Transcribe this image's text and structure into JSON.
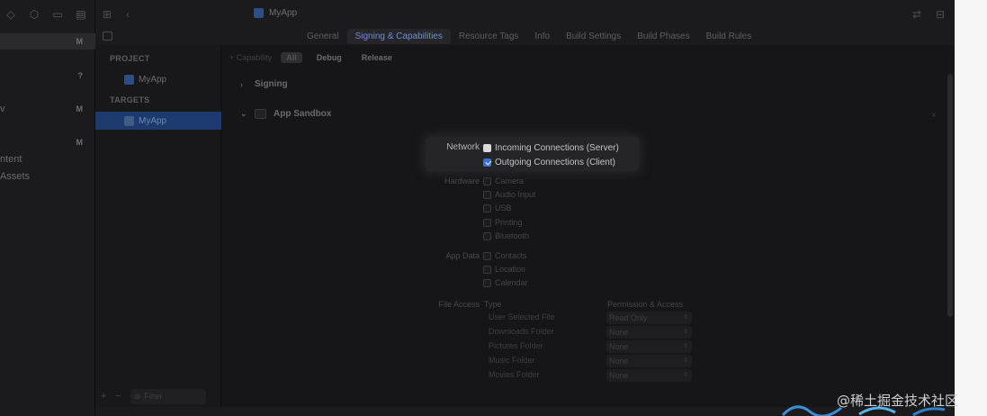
{
  "navigator": {
    "rows": [
      {
        "text": "",
        "badge": "M",
        "selected": true
      },
      {
        "text": "",
        "badge": "?"
      },
      {
        "text": "v",
        "badge": "M"
      },
      {
        "text": "",
        "badge": "M"
      },
      {
        "text": "ntent",
        "badge": ""
      },
      {
        "text": "Assets",
        "badge": ""
      }
    ]
  },
  "toolbar": {
    "project_name": "MyApp"
  },
  "tabs": [
    {
      "label": "General",
      "active": false
    },
    {
      "label": "Signing & Capabilities",
      "active": true
    },
    {
      "label": "Resource Tags",
      "active": false
    },
    {
      "label": "Info",
      "active": false
    },
    {
      "label": "Build Settings",
      "active": false
    },
    {
      "label": "Build Phases",
      "active": false
    },
    {
      "label": "Build Rules",
      "active": false
    }
  ],
  "project_list": {
    "project_header": "PROJECT",
    "project_item": "MyApp",
    "targets_header": "TARGETS",
    "target_item": "MyApp",
    "filter_placeholder": "Filter"
  },
  "config_bar": {
    "capability": "+ Capability",
    "all": "All",
    "debug": "Debug",
    "release": "Release"
  },
  "sections": {
    "signing": "Signing",
    "app_sandbox": "App Sandbox"
  },
  "sandbox": {
    "network": {
      "label": "Network",
      "options": [
        {
          "label": "Incoming Connections (Server)",
          "checked": false
        },
        {
          "label": "Outgoing Connections (Client)",
          "checked": true
        }
      ]
    },
    "hardware": {
      "label": "Hardware",
      "options": [
        "Camera",
        "Audio Input",
        "USB",
        "Printing",
        "Bluetooth"
      ]
    },
    "app_data": {
      "label": "App Data",
      "options": [
        "Contacts",
        "Location",
        "Calendar"
      ]
    },
    "file_access": {
      "label": "File Access",
      "type_header": "Type",
      "perm_header": "Permission & Access",
      "rows": [
        {
          "type": "User Selected File",
          "permission": "Read Only"
        },
        {
          "type": "Downloads Folder",
          "permission": "None"
        },
        {
          "type": "Pictures Folder",
          "permission": "None"
        },
        {
          "type": "Music Folder",
          "permission": "None"
        },
        {
          "type": "Movies Folder",
          "permission": "None"
        }
      ]
    }
  },
  "watermark": "@稀土掘金技术社区",
  "colors": {
    "accent": "#3e6fd9",
    "selection": "#1c3a6d",
    "background": "#161618"
  }
}
